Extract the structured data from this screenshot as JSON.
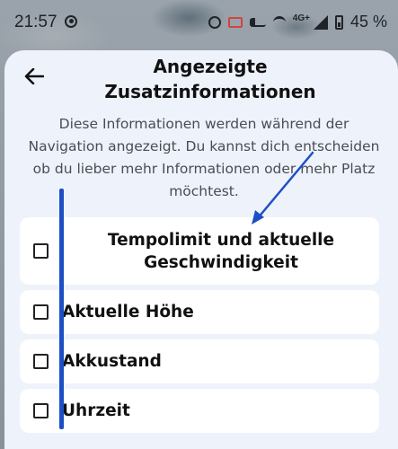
{
  "status_bar": {
    "time": "21:57",
    "network": "4G+",
    "battery": "45 %",
    "icons": [
      "data-saver-icon",
      "alarm-icon",
      "cast-icon",
      "key-icon",
      "wifi-off-icon",
      "signal-icon",
      "battery-icon"
    ]
  },
  "sheet": {
    "title": "Angezeigte Zusatzinformationen",
    "description": "Diese Informationen werden während der Navigation angezeigt. Du kannst dich entscheiden ob du lieber mehr Informationen oder mehr Platz möchtest.",
    "options": [
      {
        "label": "Tempolimit und aktuelle Geschwindigkeit",
        "checked": false
      },
      {
        "label": "Aktuelle Höhe",
        "checked": false
      },
      {
        "label": "Akkustand",
        "checked": false
      },
      {
        "label": "Uhrzeit",
        "checked": false
      }
    ]
  },
  "colors": {
    "sheet_bg": "#eef2fb",
    "card_bg": "#ffffff",
    "annotation_blue": "#1d4fc4",
    "cast_red": "#d2443b"
  }
}
